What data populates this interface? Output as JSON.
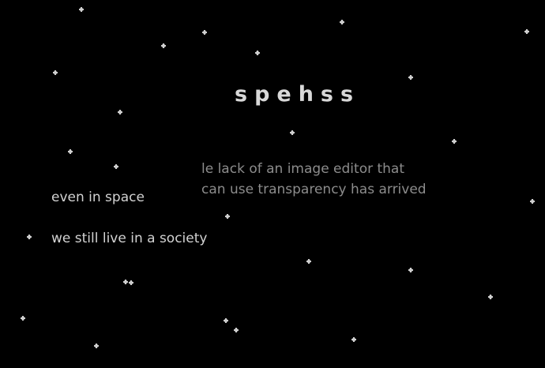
{
  "title": "spehss",
  "note": {
    "line1": "le lack of an image editor that",
    "line2": "can use transparency has arrived"
  },
  "captions": {
    "line1": "even in space",
    "line2": "we still live in a society"
  },
  "colors": {
    "background": "#000000",
    "title": "#d8d8d8",
    "note": "#8c8c8c",
    "caption": "#d2d2d2",
    "star": "#cfcfcf"
  },
  "stars_icon": "dot-star-icon"
}
